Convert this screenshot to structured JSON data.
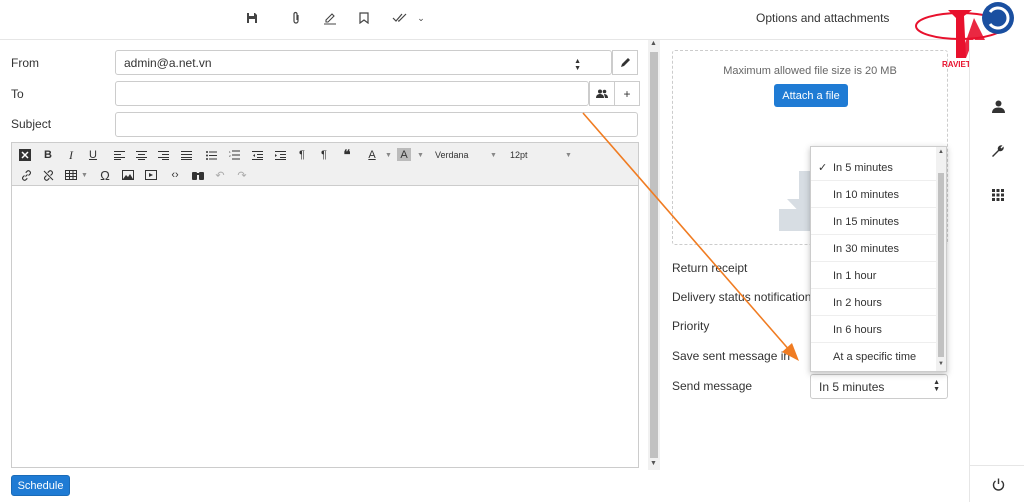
{
  "toolbar": {
    "icons": [
      "save-icon",
      "paperclip-icon",
      "signature-icon",
      "bookmark-icon",
      "double-check-icon",
      "chevron-down-icon"
    ],
    "options_title": "Options and attachments"
  },
  "logo": {
    "text": "RAVIETNAM.VN"
  },
  "compose": {
    "from_label": "From",
    "from_value": "admin@a.net.vn",
    "to_label": "To",
    "to_value": "",
    "subject_label": "Subject",
    "subject_value": ""
  },
  "editor": {
    "font_name": "Verdana",
    "font_size": "12pt",
    "text_color_label": "A",
    "bg_color_label": "A",
    "omega_label": "Ω"
  },
  "schedule_button": "Schedule",
  "attachments": {
    "max_size_text": "Maximum allowed file size is 20 MB",
    "attach_button": "Attach a file"
  },
  "options": {
    "return_receipt": "Return receipt",
    "delivery_status": "Delivery status notification",
    "priority": "Priority",
    "save_sent": "Save sent message in",
    "send_message": "Send message",
    "send_message_value": "In 5 minutes"
  },
  "dropdown": {
    "items": [
      "In 5 minutes",
      "In 10 minutes",
      "In 15 minutes",
      "In 30 minutes",
      "In 1 hour",
      "In 2 hours",
      "In 6 hours",
      "At a specific time"
    ],
    "selected": "In 5 minutes"
  },
  "colors": {
    "accent": "#1f7bd4",
    "arrow": "#f07c22",
    "logo_red": "#e8112d",
    "logo_blue": "#1a4fa0"
  }
}
